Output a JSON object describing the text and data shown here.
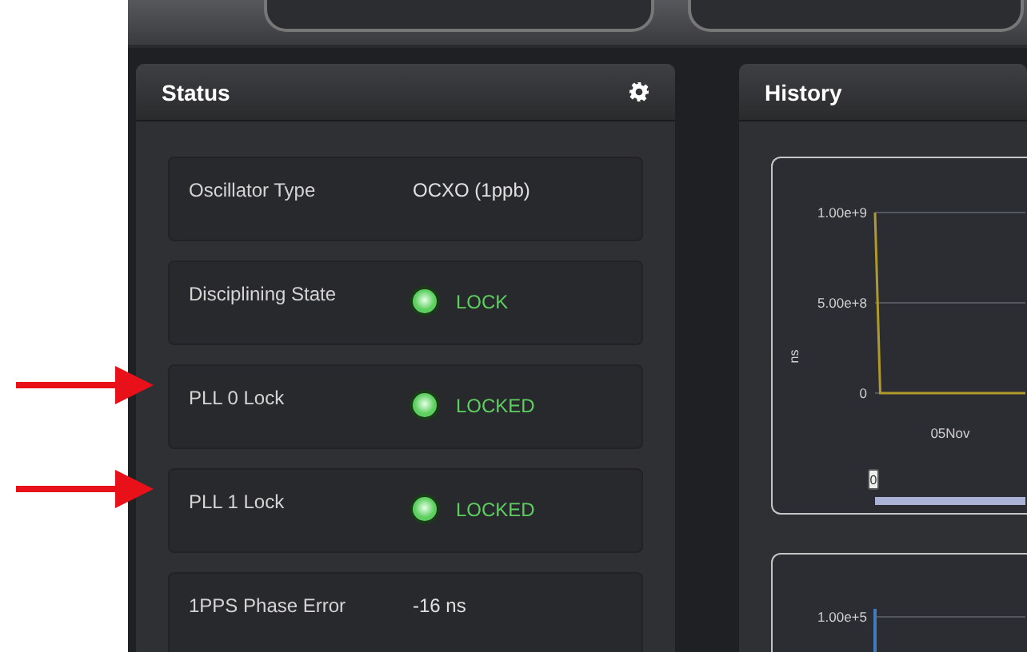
{
  "status_panel": {
    "title": "Status",
    "rows": [
      {
        "kind": "text",
        "label": "Oscillator Type",
        "value": "OCXO (1ppb)",
        "marked": false
      },
      {
        "kind": "indicator",
        "label": "Disciplining State",
        "value": "LOCK",
        "color": "#5ccf5f",
        "marked": false
      },
      {
        "kind": "indicator",
        "label": "PLL 0 Lock",
        "value": "LOCKED",
        "color": "#5ccf5f",
        "marked": true
      },
      {
        "kind": "indicator",
        "label": "PLL 1 Lock",
        "value": "LOCKED",
        "color": "#5ccf5f",
        "marked": true
      },
      {
        "kind": "text",
        "label": "1PPS Phase Error",
        "value": "-16 ns",
        "marked": false
      }
    ]
  },
  "history_panel": {
    "title": "History",
    "chart": {
      "navigator_label": "0",
      "chart_data": {
        "type": "line",
        "ylabel": "ns",
        "ylim": [
          0,
          1000000000
        ],
        "annotations": [
          {
            "text": "05Nov"
          }
        ],
        "yticks": [
          {
            "value": 0,
            "label": "0"
          },
          {
            "value": 500000000,
            "label": "5.00e+8"
          },
          {
            "value": 1000000000,
            "label": "1.00e+9"
          }
        ],
        "series": [
          {
            "color": "#b09a2c",
            "values": [
              1000000000,
              0,
              0,
              0,
              0,
              0,
              0,
              0,
              0,
              0,
              0,
              0,
              0,
              0,
              0,
              0,
              0,
              0,
              0,
              0,
              0,
              0,
              0,
              0,
              0,
              0,
              0,
              0,
              0,
              0
            ]
          }
        ]
      }
    },
    "second_chart": {
      "tick_label": "1.00e+5"
    }
  }
}
